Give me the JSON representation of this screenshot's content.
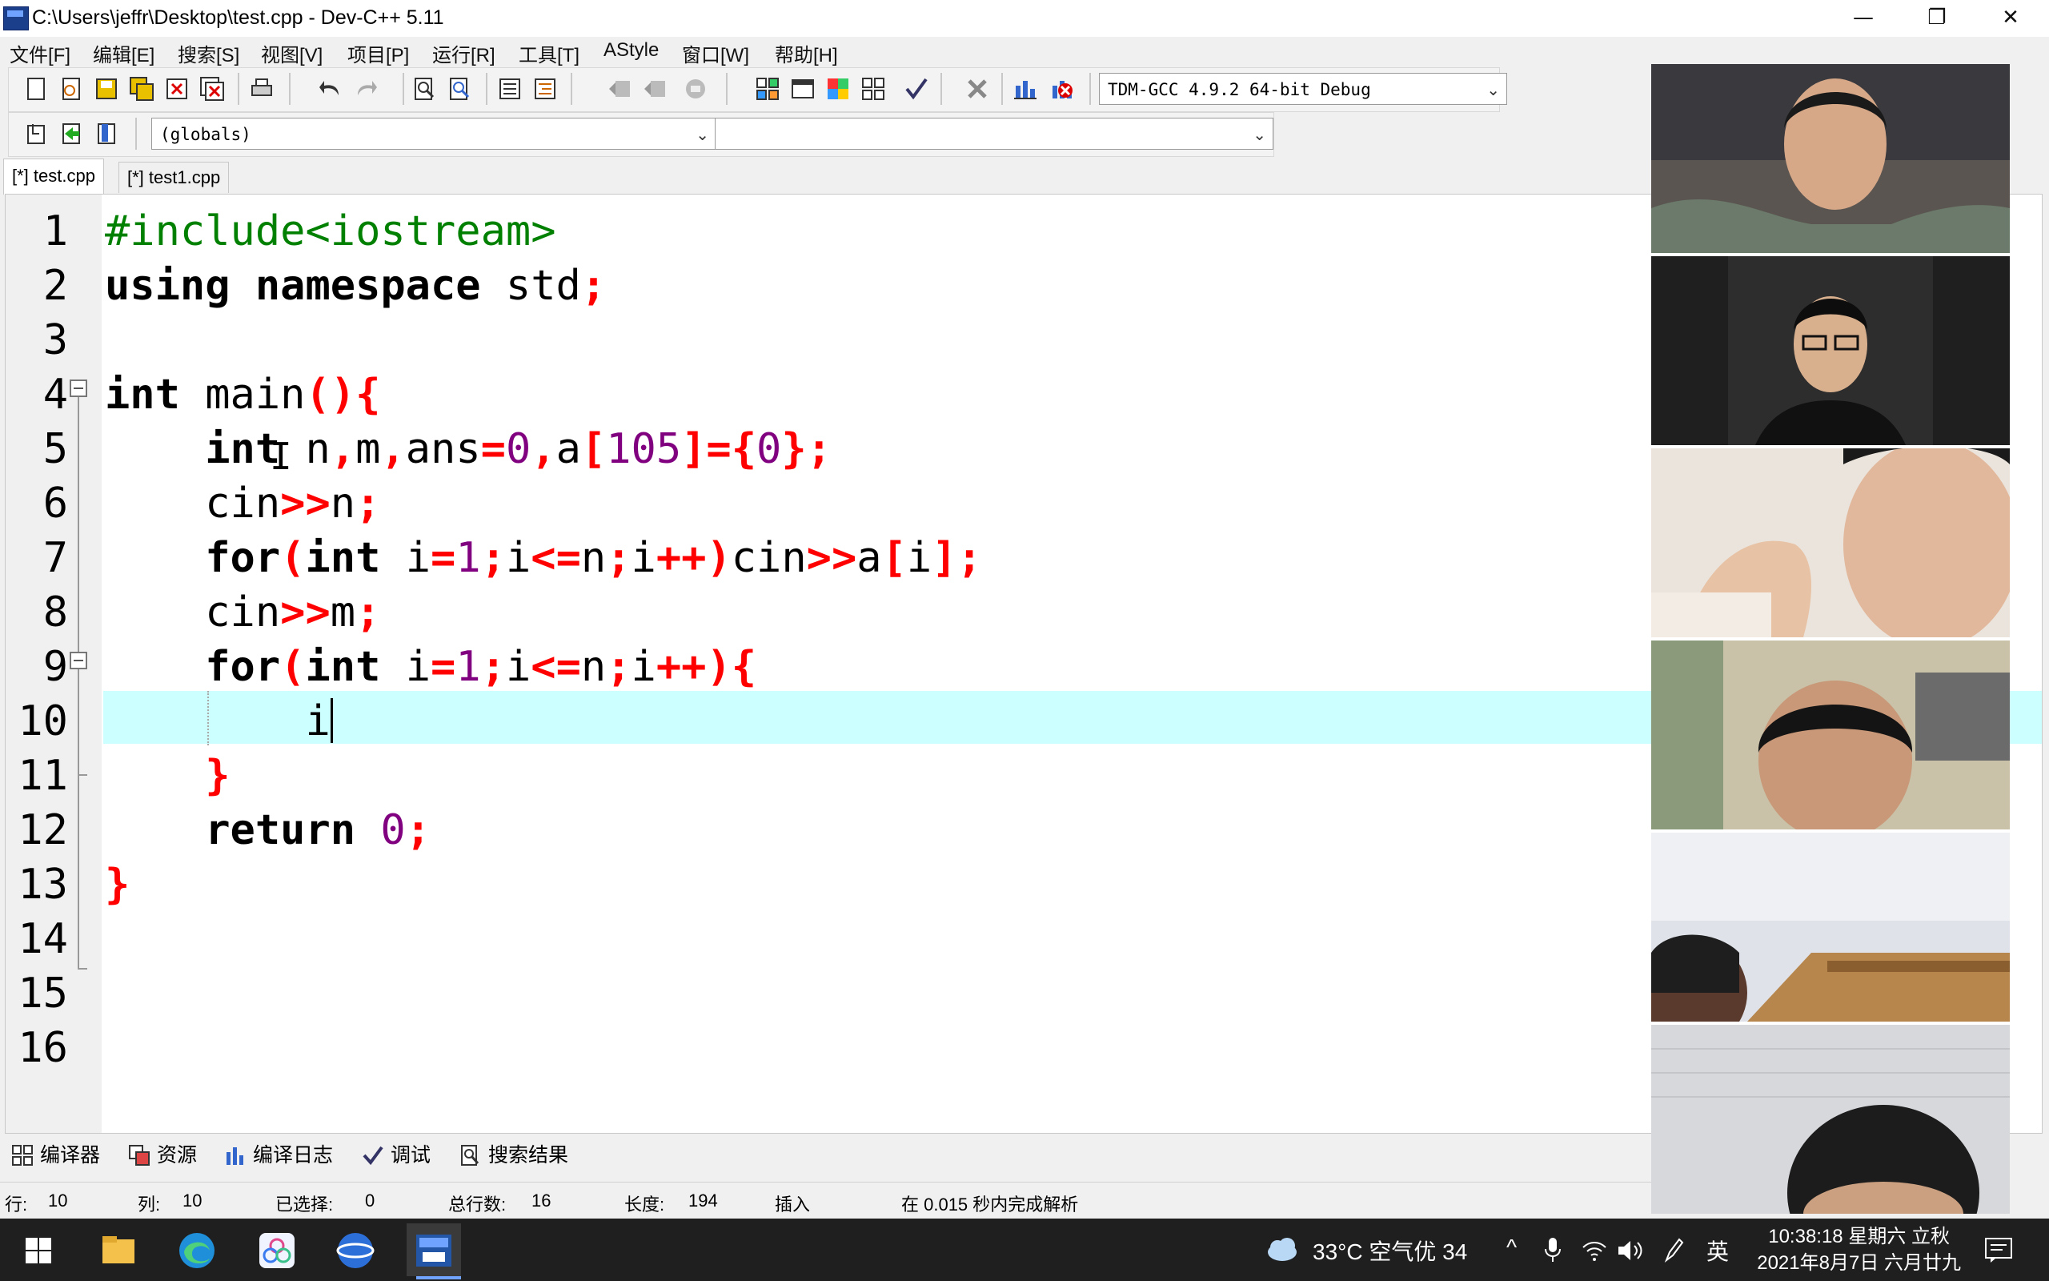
{
  "window": {
    "title": "C:\\Users\\jeffr\\Desktop\\test.cpp - Dev-C++ 5.11",
    "minimize_glyph": "—",
    "restore_glyph": "❐",
    "close_glyph": "✕"
  },
  "menu": [
    {
      "label": "文件[F]"
    },
    {
      "label": "编辑[E]"
    },
    {
      "label": "搜索[S]"
    },
    {
      "label": "视图[V]"
    },
    {
      "label": "项目[P]"
    },
    {
      "label": "运行[R]"
    },
    {
      "label": "工具[T]"
    },
    {
      "label": "AStyle"
    },
    {
      "label": "窗口[W]"
    },
    {
      "label": "帮助[H]"
    }
  ],
  "toolbar": {
    "compiler_select": "TDM-GCC 4.9.2 64-bit Debug",
    "scope_select": "(globals)",
    "symbol_select": ""
  },
  "tabs": [
    {
      "label": "[*] test.cpp",
      "active": true
    },
    {
      "label": "[*] test1.cpp",
      "active": false
    }
  ],
  "editor": {
    "line_numbers": [
      "1",
      "2",
      "3",
      "4",
      "5",
      "6",
      "7",
      "8",
      "9",
      "10",
      "11",
      "12",
      "13",
      "14",
      "15",
      "16"
    ],
    "current_line": 10,
    "code": {
      "l1": "#include<iostream>",
      "l2a": "using namespace",
      "l2b": " std",
      "l2c": ";",
      "l4a": "int",
      "l4b": " main",
      "l4c": "(){",
      "l5a": "    int",
      "l5b": " n",
      "l5c": ",",
      "l5d": "m",
      "l5e": ",",
      "l5f": "ans",
      "l5g": "=",
      "l5h": "0",
      "l5i": ",",
      "l5j": "a",
      "l5k": "[",
      "l5l": "105",
      "l5m": "]={",
      "l5n": "0",
      "l5o": "};",
      "l6a": "    cin",
      "l6b": ">>",
      "l6c": "n",
      "l6d": ";",
      "l7a": "    for",
      "l7b": "(",
      "l7c": "int",
      "l7d": " i",
      "l7e": "=",
      "l7f": "1",
      "l7g": ";",
      "l7h": "i",
      "l7i": "<=",
      "l7j": "n",
      "l7k": ";",
      "l7l": "i",
      "l7m": "++)",
      "l7n": "cin",
      "l7o": ">>",
      "l7p": "a",
      "l7q": "[",
      "l7r": "i",
      "l7s": "];",
      "l8a": "    cin",
      "l8b": ">>",
      "l8c": "m",
      "l8d": ";",
      "l9a": "    for",
      "l9b": "(",
      "l9c": "int",
      "l9d": " i",
      "l9e": "=",
      "l9f": "1",
      "l9g": ";",
      "l9h": "i",
      "l9i": "<=",
      "l9j": "n",
      "l9k": ";",
      "l9l": "i",
      "l9m": "++){",
      "l10": "        i",
      "l11": "    }",
      "l12a": "    return",
      "l12b": " 0",
      "l12c": ";",
      "l13": "}"
    }
  },
  "panel_tabs": [
    {
      "label": "编译器",
      "icon": "grid-icon"
    },
    {
      "label": "资源",
      "icon": "resources-icon"
    },
    {
      "label": "编译日志",
      "icon": "chart-icon"
    },
    {
      "label": "调试",
      "icon": "check-icon"
    },
    {
      "label": "搜索结果",
      "icon": "search-doc-icon"
    }
  ],
  "status": {
    "row_label": "行:",
    "row_value": "10",
    "col_label": "列:",
    "col_value": "10",
    "sel_label": "已选择:",
    "sel_value": "0",
    "total_label": "总行数:",
    "total_value": "16",
    "len_label": "长度:",
    "len_value": "194",
    "mode": "插入",
    "parse_msg": "在 0.015 秒内完成解析"
  },
  "taskbar": {
    "weather": "33°C 空气优 34",
    "ime": "英",
    "time": "10:38:18 星期六 立秋",
    "date": "2021年8月7日 六月廿九",
    "tray_arrow": "^"
  },
  "colors": {
    "current_line": "#ccffff",
    "preprocessor": "#008000",
    "symbol": "#ff0000",
    "number": "#800080"
  }
}
